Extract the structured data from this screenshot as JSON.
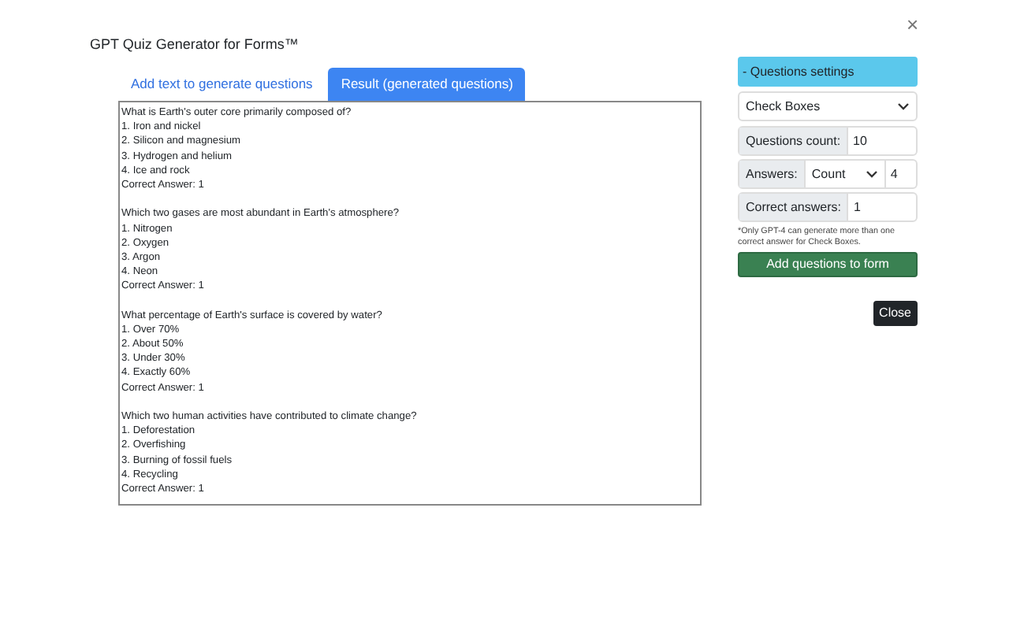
{
  "dialog": {
    "title": "GPT Quiz Generator for Forms™",
    "close": "×"
  },
  "tabs": [
    {
      "label": "Add text to generate questions",
      "selected": false
    },
    {
      "label": "Result (generated questions)",
      "selected": true
    }
  ],
  "result_blocks": [
    {
      "lines": [
        "What is Earth's outer core primarily composed of?",
        "1. Iron and nickel",
        "2. Silicon and magnesium",
        "3. Hydrogen and helium",
        "4. Ice and rock",
        "Correct Answer: 1"
      ]
    },
    {
      "lines": [
        "Which two gases are most abundant in Earth's atmosphere?",
        "1. Nitrogen",
        "2. Oxygen",
        "3. Argon",
        "4. Neon",
        "Correct Answer: 1"
      ]
    },
    {
      "lines": [
        "What percentage of Earth's surface is covered by water?",
        "1. Over 70%",
        "2. About 50%",
        "3. Under 30%",
        "4. Exactly 60%",
        "Correct Answer: 1"
      ]
    },
    {
      "lines": [
        "Which two human activities have contributed to climate change?",
        "1. Deforestation",
        "2. Overfishing",
        "3. Burning of fossil fuels",
        "4. Recycling",
        "Correct Answer: 1"
      ]
    }
  ],
  "settings": {
    "header": "- Questions settings",
    "type_select": "Check Boxes",
    "questions_count": {
      "label": "Questions count:",
      "value": "10"
    },
    "answers": {
      "label": "Answers:",
      "mode": "Count",
      "value": "4"
    },
    "correct_answers": {
      "label": "Correct answers:",
      "value": "1"
    },
    "note": "*Only GPT-4 can generate more than one correct answer for Check Boxes.",
    "add_button": "Add questions to form"
  },
  "close_button": "Close"
}
